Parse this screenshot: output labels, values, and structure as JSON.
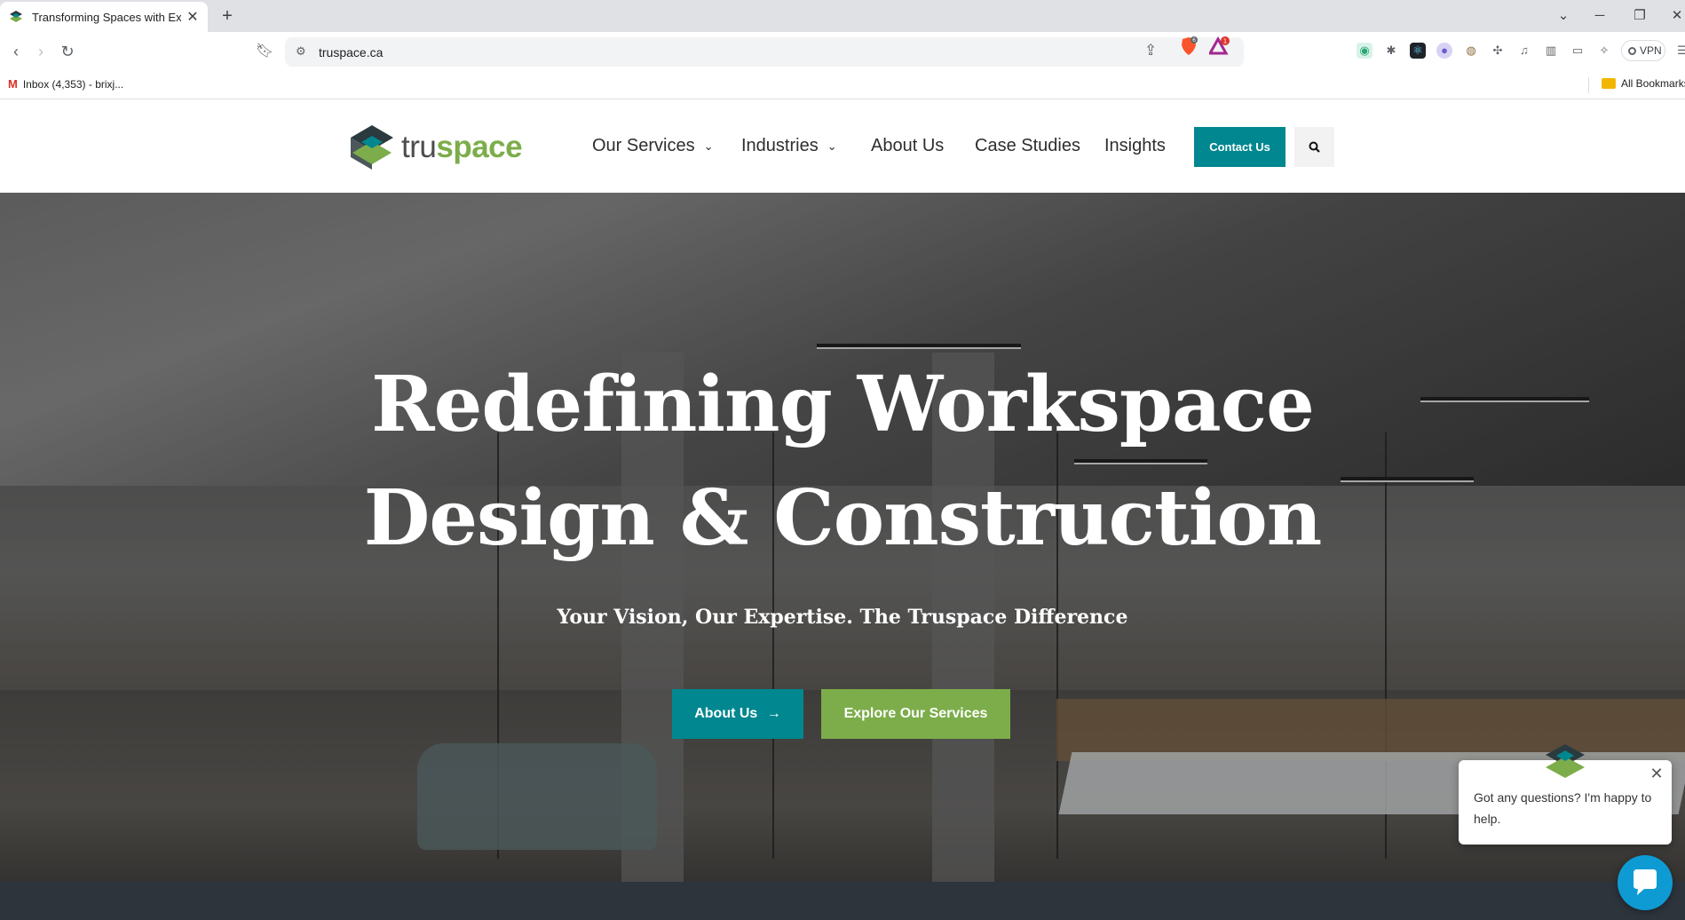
{
  "browser": {
    "tab_title": "Transforming Spaces with Expe",
    "new_tab": "+",
    "url": "truspace.ca",
    "rewards_count": "1",
    "brave_count": "6",
    "vpn_label": "VPN",
    "bookmarks": {
      "gmail_label": "Inbox (4,353) - brixj...",
      "all_bookmarks": "All Bookmarks"
    }
  },
  "site": {
    "logo": {
      "tru": "tru",
      "space": "space"
    },
    "nav": {
      "services": "Our Services",
      "industries": "Industries",
      "about": "About Us",
      "case_studies": "Case Studies",
      "insights": "Insights"
    },
    "contact_label": "Contact Us"
  },
  "hero": {
    "title_line1": "Redefining Workspace",
    "title_line2": "Design & Construction",
    "subtitle": "Your Vision, Our Expertise. The Truspace Difference",
    "about_button": "About Us",
    "explore_button": "Explore Our Services"
  },
  "chat": {
    "message": "Got any questions? I'm happy to help."
  },
  "colors": {
    "teal": "#00878f",
    "green": "#7cad4a",
    "chat_blue": "#0e9bd4"
  }
}
